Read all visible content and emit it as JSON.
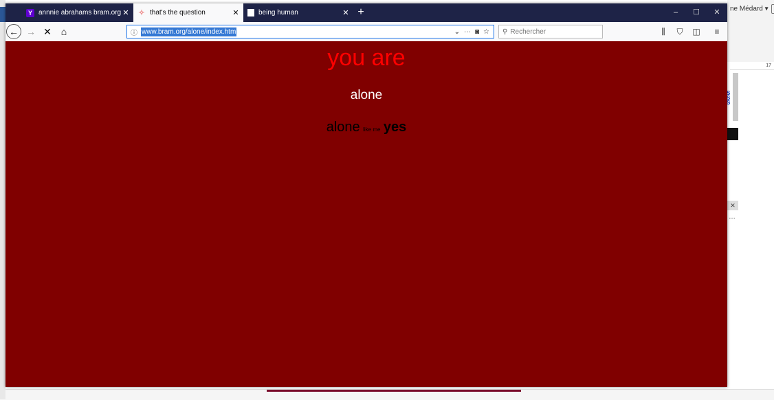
{
  "browser": {
    "tabs": [
      {
        "favicon": "Y",
        "title": "annnie abrahams bram.org sea",
        "active": false
      },
      {
        "favicon": "✧",
        "title": "that's the question",
        "active": true
      },
      {
        "favicon": "",
        "title": "being human",
        "active": false
      }
    ],
    "new_tab": "+",
    "url": "www.bram.org/alone/index.htm",
    "search_placeholder": "Rechercher",
    "window_controls": {
      "minimize": "–",
      "maximize": "☐",
      "close": "✕"
    }
  },
  "page": {
    "headline": "you are",
    "line2": "alone",
    "line3": {
      "word1": "alone",
      "word2": "like me",
      "word3": "yes"
    },
    "colors": {
      "background": "#800000",
      "headline": "#ff0000",
      "line2": "#ffffff",
      "line3": "#000000"
    }
  },
  "background_app": {
    "user_name": "ne Médard",
    "ruler_number": "17"
  }
}
